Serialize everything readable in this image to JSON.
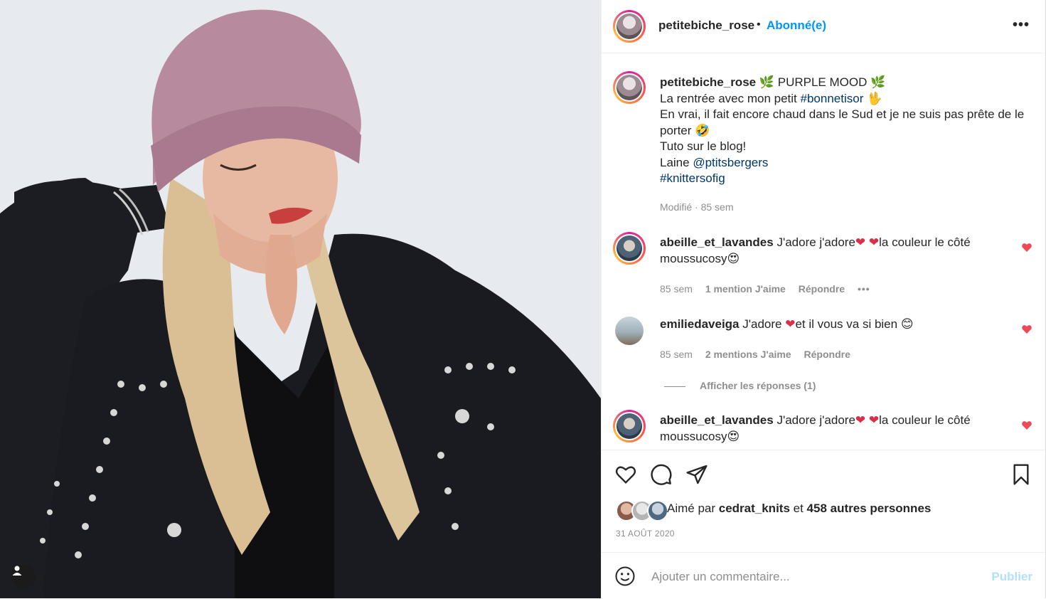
{
  "post": {
    "author": "petitebiche_rose",
    "follow_status": "Abonné(e)",
    "caption": {
      "title": "PURPLE MOOD",
      "line1_prefix": "La rentrée avec mon petit ",
      "line1_hashtag": "#bonnetisor",
      "line2": "En vrai, il fait encore chaud dans le Sud et je ne suis pas prête de le porter",
      "line3": "Tuto sur le blog!",
      "line4_prefix": "Laine ",
      "line4_mention": "@ptitsbergers",
      "line5_hashtag": "#knittersofig",
      "meta": "Modifié · 85 sem"
    }
  },
  "comments": [
    {
      "user": "abeille_et_lavandes",
      "text_a": "J'adore j'adore",
      "text_b": "la couleur le côté moussucosy",
      "time": "85 sem",
      "likes": "1 mention J'aime",
      "reply": "Répondre"
    },
    {
      "user": "emiliedaveiga",
      "text_a": "J'adore ",
      "text_b": "et il vous va si bien ",
      "time": "85 sem",
      "likes": "2 mentions J'aime",
      "reply": "Répondre"
    },
    {
      "user": "abeille_et_lavandes",
      "text_a": "J'adore j'adore",
      "text_b": "la couleur le côté moussucosy"
    }
  ],
  "view_replies": "Afficher les réponses (1)",
  "likes": {
    "prefix": "Aimé par ",
    "user": "cedrat_knits",
    "middle": " et ",
    "others": "458 autres personnes"
  },
  "date": "31 AOÛT 2020",
  "add_comment": {
    "placeholder": "Ajouter un commentaire...",
    "post_label": "Publier"
  },
  "icons": [
    "more-icon",
    "heart-icon",
    "comment-icon",
    "share-icon",
    "bookmark-icon",
    "emoji-icon",
    "user-tag-icon",
    "leaf-emoji",
    "hand-emoji",
    "laugh-emoji",
    "heart-emoji",
    "smile-emoji"
  ],
  "colors": {
    "link": "#0095f6",
    "tag": "#00376b",
    "like": "#ed4956",
    "muted": "#8e8e8e"
  }
}
